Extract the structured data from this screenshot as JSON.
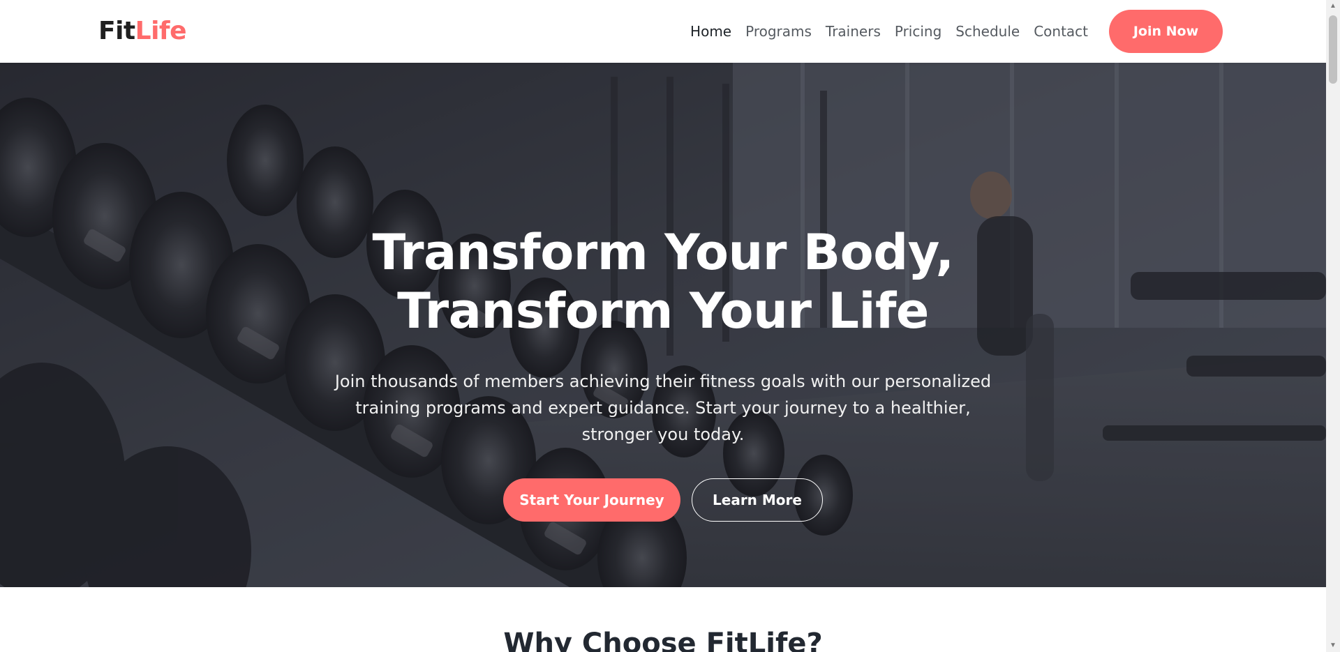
{
  "brand": {
    "part1": "Fit",
    "part2": "Life"
  },
  "nav": {
    "links": [
      "Home",
      "Programs",
      "Trainers",
      "Pricing",
      "Schedule",
      "Contact"
    ],
    "cta": "Join Now"
  },
  "hero": {
    "title_line1": "Transform Your Body,",
    "title_line2": "Transform Your Life",
    "subtitle": "Join thousands of members achieving their fitness goals with our personalized training programs and expert guidance. Start your journey to a healthier, stronger you today.",
    "primary_button": "Start Your Journey",
    "secondary_button": "Learn More"
  },
  "why": {
    "title": "Why Choose FitLife?"
  },
  "colors": {
    "accent": "#ff6b6b",
    "text_dark": "#222831",
    "nav_text": "#555a60"
  },
  "icons": {
    "scroll_up": "triangle-up-icon",
    "scroll_down": "triangle-down-icon"
  }
}
